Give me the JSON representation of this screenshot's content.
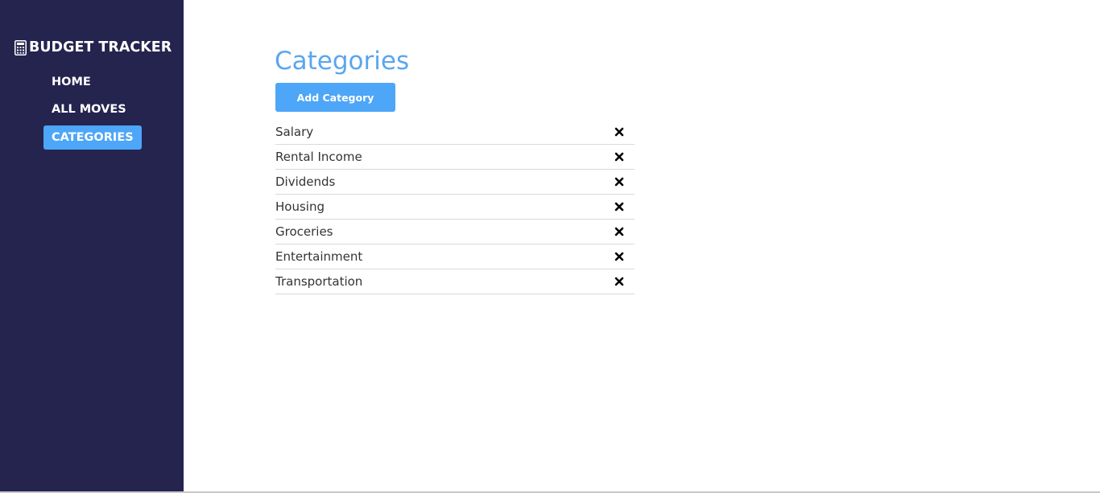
{
  "sidebar": {
    "brand": {
      "icon": "calculator-icon",
      "title": "BUDGET TRACKER"
    },
    "items": [
      {
        "label": "HOME",
        "active": false
      },
      {
        "label": "ALL MOVES",
        "active": false
      },
      {
        "label": "CATEGORIES",
        "active": true
      }
    ]
  },
  "main": {
    "title": "Categories",
    "add_button_label": "Add Category",
    "categories": [
      {
        "name": "Salary",
        "action_icon": "close-icon"
      },
      {
        "name": "Rental Income",
        "action_icon": "close-icon"
      },
      {
        "name": "Dividends",
        "action_icon": "close-icon"
      },
      {
        "name": "Housing",
        "action_icon": "close-icon"
      },
      {
        "name": "Groceries",
        "action_icon": "close-icon"
      },
      {
        "name": "Entertainment",
        "action_icon": "close-icon"
      },
      {
        "name": "Transportation",
        "action_icon": "close-icon"
      }
    ]
  },
  "colors": {
    "sidebar_bg": "#25244f",
    "accent": "#4da6f7",
    "title": "#5aa6ef",
    "text": "#333333",
    "divider": "#d9d9d9"
  }
}
